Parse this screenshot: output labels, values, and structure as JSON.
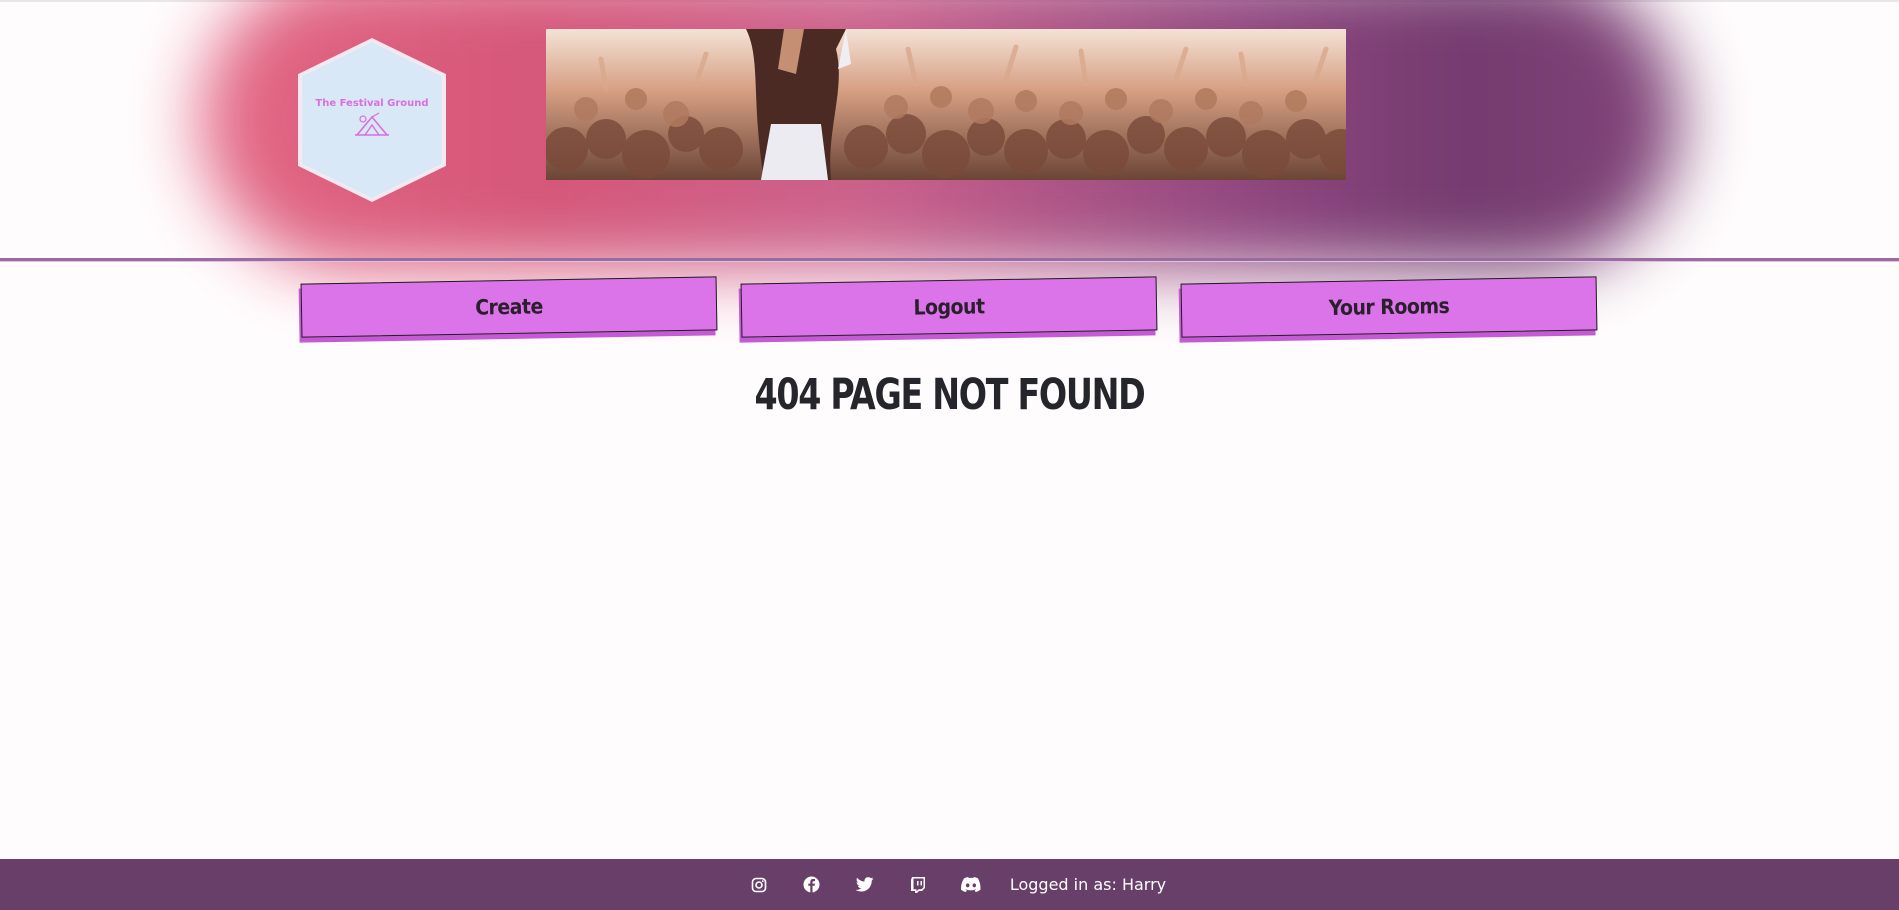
{
  "brand": {
    "logo_text": "The Festival Ground"
  },
  "nav": {
    "create_label": "Create",
    "logout_label": "Logout",
    "rooms_label": "Your Rooms"
  },
  "main": {
    "heading": "404 PAGE NOT FOUND"
  },
  "footer": {
    "icons": [
      "instagram-icon",
      "facebook-icon",
      "twitter-icon",
      "twitch-icon",
      "discord-icon"
    ],
    "status_prefix": "Logged in as:",
    "username": "Harry"
  },
  "colors": {
    "accent": "#da74e8",
    "footer_bg": "#673f69",
    "divider": "#9a6aa0",
    "logo_bg": "#d9e8f7",
    "heading_text": "#24262b"
  }
}
